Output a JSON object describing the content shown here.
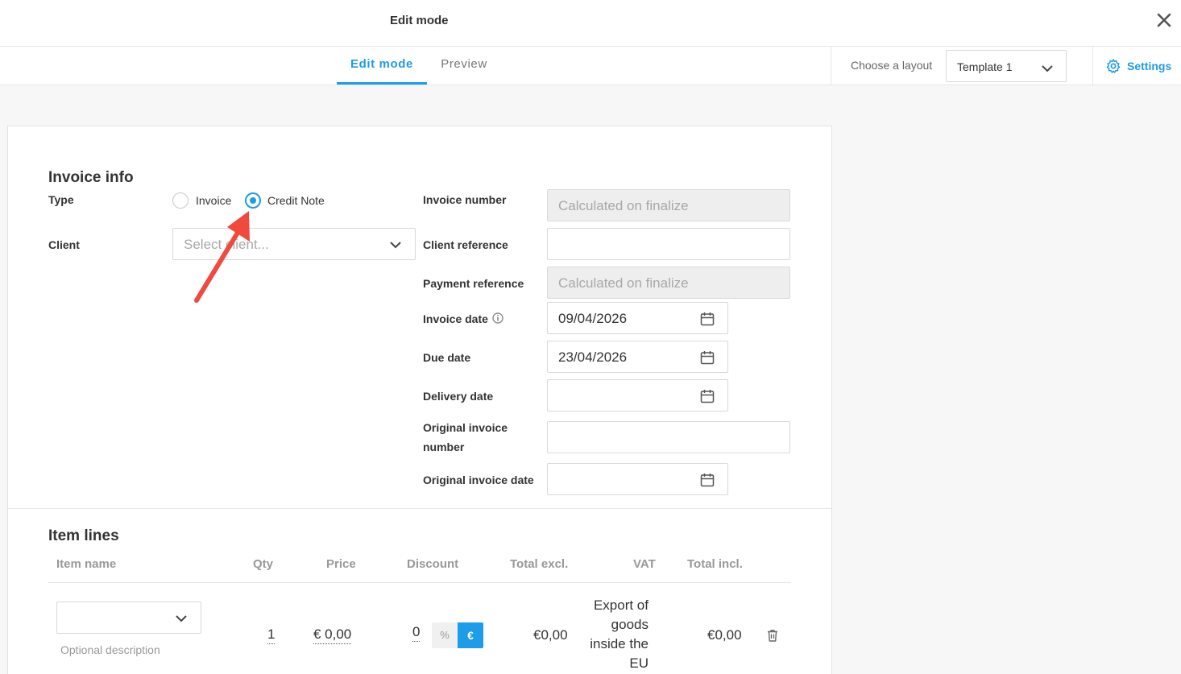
{
  "header": {
    "title": "Edit mode",
    "close_icon": "close-icon"
  },
  "tabs": [
    {
      "label": "Edit mode",
      "active": true
    },
    {
      "label": "Preview",
      "active": false
    }
  ],
  "layout": {
    "label": "Choose a layout",
    "selected": "Template 1"
  },
  "settings": {
    "label": "Settings",
    "icon": "gear-icon"
  },
  "invoice_info": {
    "heading": "Invoice info",
    "type_label": "Type",
    "type_options": [
      {
        "label": "Invoice",
        "checked": false
      },
      {
        "label": "Credit Note",
        "checked": true
      }
    ],
    "client_label": "Client",
    "client_placeholder": "Select client...",
    "invoice_number_label": "Invoice number",
    "invoice_number_value": "Calculated on finalize",
    "client_reference_label": "Client reference",
    "client_reference_value": "",
    "payment_reference_label": "Payment reference",
    "payment_reference_value": "Calculated on finalize",
    "invoice_date_label": "Invoice date",
    "invoice_date_value": "09/04/2026",
    "due_date_label": "Due date",
    "due_date_value": "23/04/2026",
    "delivery_date_label": "Delivery date",
    "delivery_date_value": "",
    "original_invoice_number_label_1": "Original invoice",
    "original_invoice_number_label_2": "number",
    "original_invoice_number_value": "",
    "original_invoice_date_label": "Original invoice date",
    "original_invoice_date_value": ""
  },
  "item_lines": {
    "heading": "Item lines",
    "columns": [
      "Item name",
      "Qty",
      "Price",
      "Discount",
      "Total excl.",
      "VAT",
      "Total incl."
    ],
    "rows": [
      {
        "item_name": "",
        "description_placeholder": "Optional description",
        "qty": "1",
        "price": "€ 0,00",
        "discount": "0",
        "discount_pct_label": "%",
        "discount_eur_label": "€",
        "total_excl": "€0,00",
        "vat": "Export of goods inside the EU",
        "total_incl": "€0,00"
      }
    ]
  },
  "colors": {
    "accent": "#1e9be9",
    "annotation_arrow": "#f04a3e"
  }
}
